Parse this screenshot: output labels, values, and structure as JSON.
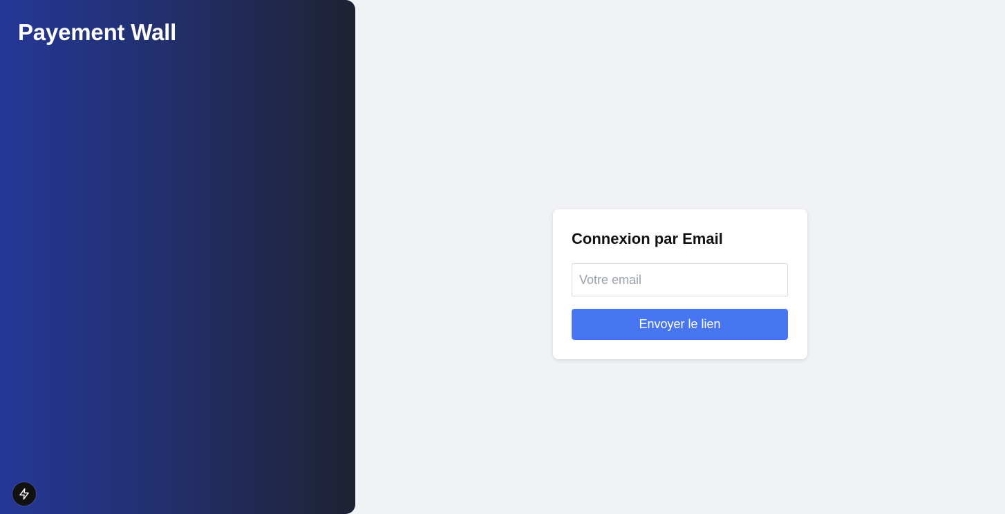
{
  "sidebar": {
    "title": "Payement Wall",
    "badge_icon": "lightning-bolt-icon"
  },
  "login": {
    "heading": "Connexion par Email",
    "email_placeholder": "Votre email",
    "email_value": "",
    "submit_label": "Envoyer le lien"
  },
  "colors": {
    "sidebar_gradient_start": "#243796",
    "sidebar_gradient_end": "#1f2233",
    "background": "#f0f2f5",
    "button": "#4876f0",
    "card": "#ffffff"
  }
}
